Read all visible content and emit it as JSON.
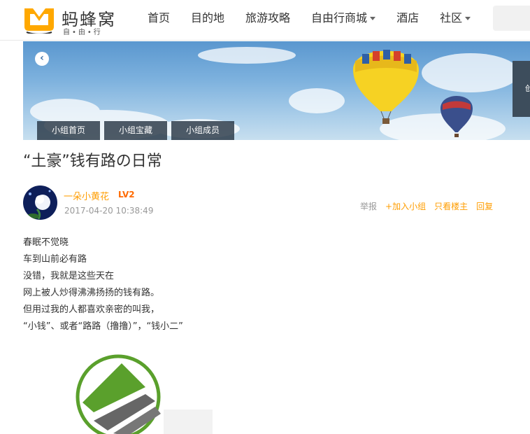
{
  "header": {
    "logo_title": "蚂蜂窝",
    "logo_subtitle": "自•由•行",
    "nav": [
      {
        "label": "首页",
        "dropdown": false
      },
      {
        "label": "目的地",
        "dropdown": false
      },
      {
        "label": "旅游攻略",
        "dropdown": false
      },
      {
        "label": "自由行商城",
        "dropdown": true
      },
      {
        "label": "酒店",
        "dropdown": false
      },
      {
        "label": "社区",
        "dropdown": true
      }
    ],
    "brand_color": "#ffa800"
  },
  "banner": {
    "prev_icon": "‹",
    "side_text": "创",
    "tabs": [
      "小组首页",
      "小组宝藏",
      "小组成员"
    ]
  },
  "post": {
    "title": "“土豪”钱有路の日常",
    "author": "一朵小黄花",
    "level": "LV2",
    "time": "2017-04-20 10:38:49",
    "actions": {
      "report": "举报",
      "join": "+加入小组",
      "only_author": "只看楼主",
      "reply": "回复"
    },
    "lines": [
      "春眠不觉晓",
      "车到山前必有路",
      "没错，我就是这些天在",
      "网上被人炒得沸沸扬扬的钱有路。",
      "但用过我的人都喜欢亲密的叫我，",
      "“小钱”、或者“路路（撸撸）”，“钱小二”"
    ]
  }
}
